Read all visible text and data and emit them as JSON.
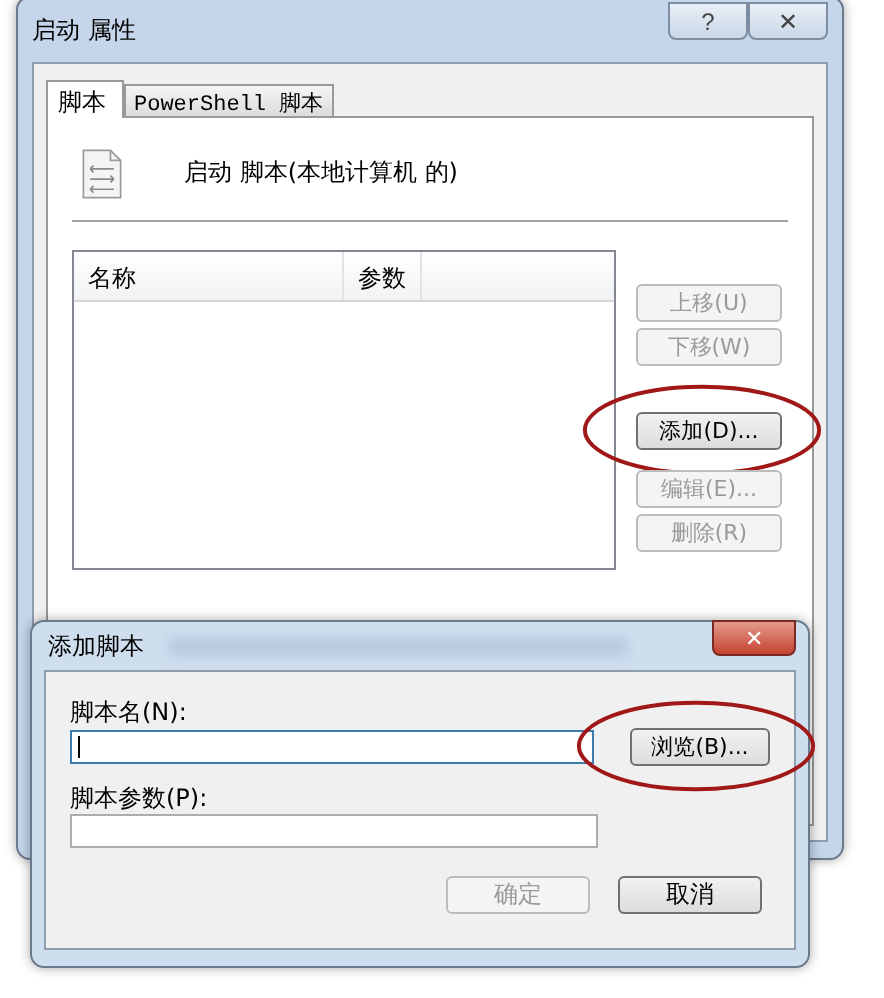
{
  "window": {
    "title": "启动 属性",
    "caption_buttons": [
      "?",
      "✕"
    ]
  },
  "tabs": [
    {
      "label": "脚本",
      "selected": true
    },
    {
      "label": "PowerShell 脚本",
      "selected": false
    }
  ],
  "heading": "启动 脚本(本地计算机 的)",
  "table": {
    "columns": [
      "名称",
      "参数"
    ]
  },
  "side_buttons": [
    {
      "label": "上移(U)",
      "disabled": true,
      "circled": false,
      "gap": false
    },
    {
      "label": "下移(W)",
      "disabled": true,
      "circled": false,
      "gap": false
    },
    {
      "label": "添加(D)...",
      "disabled": false,
      "circled": true,
      "gap": true
    },
    {
      "label": "编辑(E)...",
      "disabled": true,
      "circled": false,
      "gap": false
    },
    {
      "label": "删除(R)",
      "disabled": true,
      "circled": false,
      "gap": false
    }
  ],
  "dialog": {
    "title": "添加脚本",
    "close": "✕",
    "fields": [
      {
        "label": "脚本名(N):",
        "focused": true,
        "button": {
          "label": "浏览(B)...",
          "circled": true
        }
      },
      {
        "label": "脚本参数(P):",
        "focused": false
      }
    ],
    "buttons": [
      {
        "label": "确定",
        "disabled": true
      },
      {
        "label": "取消",
        "disabled": false
      }
    ]
  }
}
